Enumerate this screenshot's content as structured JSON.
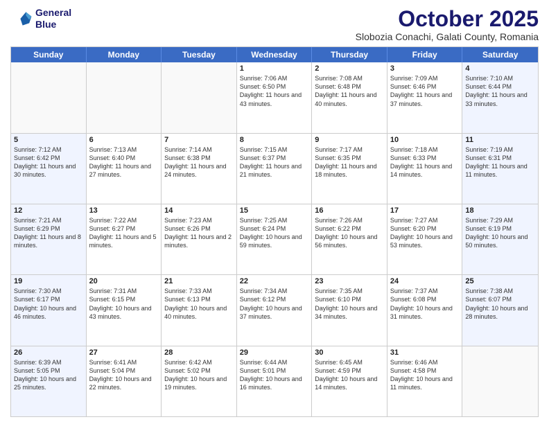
{
  "logo": {
    "line1": "General",
    "line2": "Blue"
  },
  "title": "October 2025",
  "subtitle": "Slobozia Conachi, Galati County, Romania",
  "headers": [
    "Sunday",
    "Monday",
    "Tuesday",
    "Wednesday",
    "Thursday",
    "Friday",
    "Saturday"
  ],
  "weeks": [
    [
      {
        "day": "",
        "info": ""
      },
      {
        "day": "",
        "info": ""
      },
      {
        "day": "",
        "info": ""
      },
      {
        "day": "1",
        "info": "Sunrise: 7:06 AM\nSunset: 6:50 PM\nDaylight: 11 hours and 43 minutes."
      },
      {
        "day": "2",
        "info": "Sunrise: 7:08 AM\nSunset: 6:48 PM\nDaylight: 11 hours and 40 minutes."
      },
      {
        "day": "3",
        "info": "Sunrise: 7:09 AM\nSunset: 6:46 PM\nDaylight: 11 hours and 37 minutes."
      },
      {
        "day": "4",
        "info": "Sunrise: 7:10 AM\nSunset: 6:44 PM\nDaylight: 11 hours and 33 minutes."
      }
    ],
    [
      {
        "day": "5",
        "info": "Sunrise: 7:12 AM\nSunset: 6:42 PM\nDaylight: 11 hours and 30 minutes."
      },
      {
        "day": "6",
        "info": "Sunrise: 7:13 AM\nSunset: 6:40 PM\nDaylight: 11 hours and 27 minutes."
      },
      {
        "day": "7",
        "info": "Sunrise: 7:14 AM\nSunset: 6:38 PM\nDaylight: 11 hours and 24 minutes."
      },
      {
        "day": "8",
        "info": "Sunrise: 7:15 AM\nSunset: 6:37 PM\nDaylight: 11 hours and 21 minutes."
      },
      {
        "day": "9",
        "info": "Sunrise: 7:17 AM\nSunset: 6:35 PM\nDaylight: 11 hours and 18 minutes."
      },
      {
        "day": "10",
        "info": "Sunrise: 7:18 AM\nSunset: 6:33 PM\nDaylight: 11 hours and 14 minutes."
      },
      {
        "day": "11",
        "info": "Sunrise: 7:19 AM\nSunset: 6:31 PM\nDaylight: 11 hours and 11 minutes."
      }
    ],
    [
      {
        "day": "12",
        "info": "Sunrise: 7:21 AM\nSunset: 6:29 PM\nDaylight: 11 hours and 8 minutes."
      },
      {
        "day": "13",
        "info": "Sunrise: 7:22 AM\nSunset: 6:27 PM\nDaylight: 11 hours and 5 minutes."
      },
      {
        "day": "14",
        "info": "Sunrise: 7:23 AM\nSunset: 6:26 PM\nDaylight: 11 hours and 2 minutes."
      },
      {
        "day": "15",
        "info": "Sunrise: 7:25 AM\nSunset: 6:24 PM\nDaylight: 10 hours and 59 minutes."
      },
      {
        "day": "16",
        "info": "Sunrise: 7:26 AM\nSunset: 6:22 PM\nDaylight: 10 hours and 56 minutes."
      },
      {
        "day": "17",
        "info": "Sunrise: 7:27 AM\nSunset: 6:20 PM\nDaylight: 10 hours and 53 minutes."
      },
      {
        "day": "18",
        "info": "Sunrise: 7:29 AM\nSunset: 6:19 PM\nDaylight: 10 hours and 50 minutes."
      }
    ],
    [
      {
        "day": "19",
        "info": "Sunrise: 7:30 AM\nSunset: 6:17 PM\nDaylight: 10 hours and 46 minutes."
      },
      {
        "day": "20",
        "info": "Sunrise: 7:31 AM\nSunset: 6:15 PM\nDaylight: 10 hours and 43 minutes."
      },
      {
        "day": "21",
        "info": "Sunrise: 7:33 AM\nSunset: 6:13 PM\nDaylight: 10 hours and 40 minutes."
      },
      {
        "day": "22",
        "info": "Sunrise: 7:34 AM\nSunset: 6:12 PM\nDaylight: 10 hours and 37 minutes."
      },
      {
        "day": "23",
        "info": "Sunrise: 7:35 AM\nSunset: 6:10 PM\nDaylight: 10 hours and 34 minutes."
      },
      {
        "day": "24",
        "info": "Sunrise: 7:37 AM\nSunset: 6:08 PM\nDaylight: 10 hours and 31 minutes."
      },
      {
        "day": "25",
        "info": "Sunrise: 7:38 AM\nSunset: 6:07 PM\nDaylight: 10 hours and 28 minutes."
      }
    ],
    [
      {
        "day": "26",
        "info": "Sunrise: 6:39 AM\nSunset: 5:05 PM\nDaylight: 10 hours and 25 minutes."
      },
      {
        "day": "27",
        "info": "Sunrise: 6:41 AM\nSunset: 5:04 PM\nDaylight: 10 hours and 22 minutes."
      },
      {
        "day": "28",
        "info": "Sunrise: 6:42 AM\nSunset: 5:02 PM\nDaylight: 10 hours and 19 minutes."
      },
      {
        "day": "29",
        "info": "Sunrise: 6:44 AM\nSunset: 5:01 PM\nDaylight: 10 hours and 16 minutes."
      },
      {
        "day": "30",
        "info": "Sunrise: 6:45 AM\nSunset: 4:59 PM\nDaylight: 10 hours and 14 minutes."
      },
      {
        "day": "31",
        "info": "Sunrise: 6:46 AM\nSunset: 4:58 PM\nDaylight: 10 hours and 11 minutes."
      },
      {
        "day": "",
        "info": ""
      }
    ]
  ]
}
